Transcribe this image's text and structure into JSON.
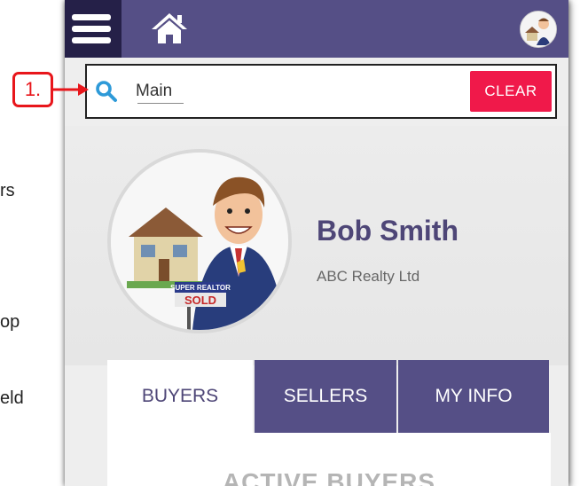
{
  "background_doc": {
    "fragments": [
      "rs",
      "op",
      "eld"
    ]
  },
  "topbar": {
    "menu_icon": "hamburger-menu-icon",
    "home_icon": "home-icon",
    "avatar_icon": "profile-avatar-icon",
    "colors": {
      "bar": "#554f86",
      "menu_bg": "#252048"
    }
  },
  "search": {
    "icon": "search-icon",
    "value": "Main",
    "clear_label": "CLEAR",
    "clear_color": "#f0194a"
  },
  "profile": {
    "name": "Bob Smith",
    "company": "ABC Realty Ltd",
    "sign_text_top": "SUPER REALTOR",
    "sign_text_bottom": "SOLD"
  },
  "tabs": [
    {
      "label": "BUYERS",
      "active": true
    },
    {
      "label": "SELLERS",
      "active": false
    },
    {
      "label": "MY INFO",
      "active": false
    }
  ],
  "section": {
    "heading": "ACTIVE BUYERS"
  },
  "annotation": {
    "label": "1.",
    "color": "#e8161b"
  }
}
